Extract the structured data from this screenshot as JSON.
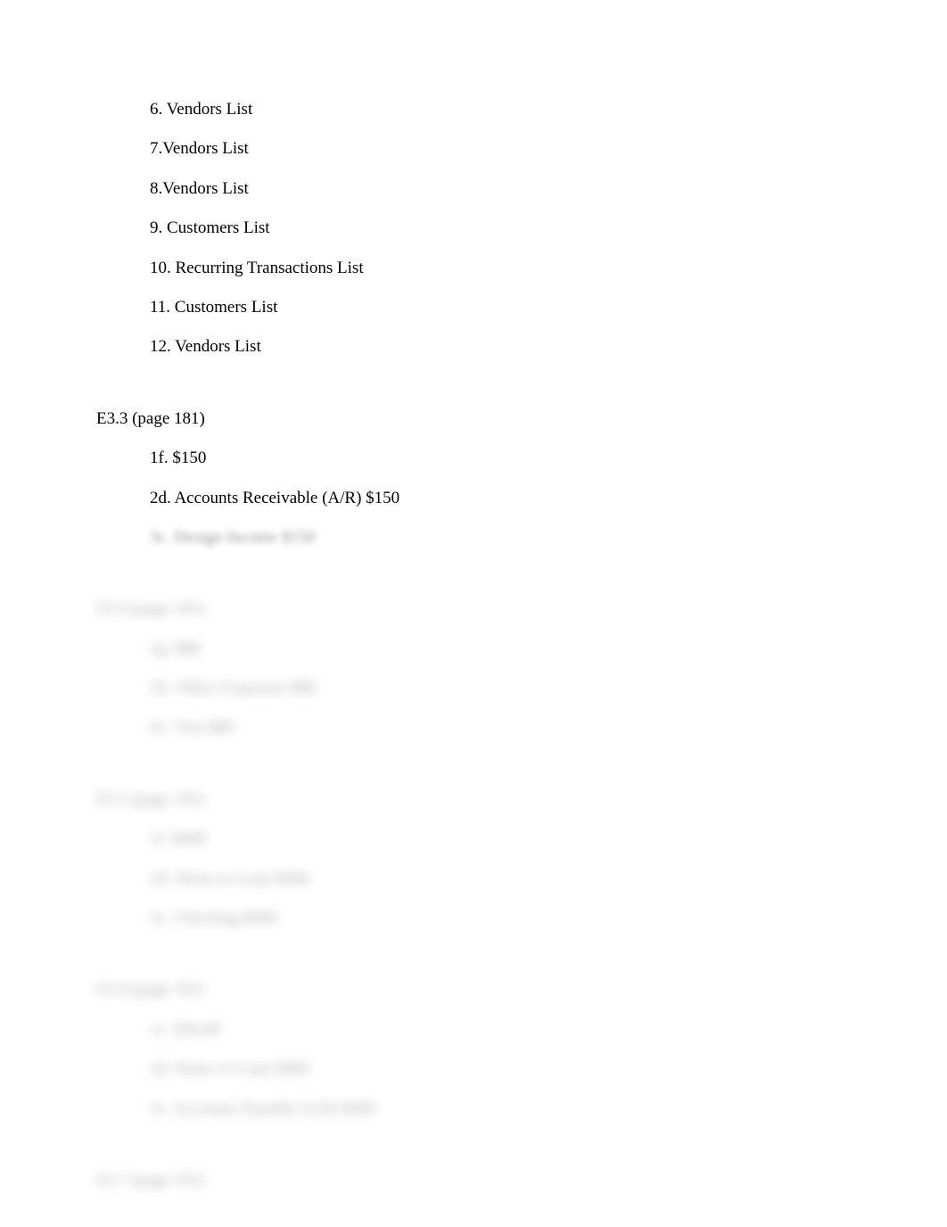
{
  "visible": {
    "top_list": [
      "6. Vendors List",
      "7.Vendors List",
      "8.Vendors List",
      "9. Customers List",
      "10. Recurring Transactions List",
      "11. Customers List",
      "12. Vendors List"
    ],
    "section_heading": "E3.3 (page 181)",
    "section_items": [
      "1f.  $150",
      "2d. Accounts Receivable (A/R) $150"
    ]
  },
  "blurred": {
    "line_1": "3c. Design Income $150",
    "sections": [
      {
        "heading": "E3.4 (page 181)",
        "items": [
          "1g. $80",
          "2b. Office Expenses $80",
          "3c. Visa $80"
        ]
      },
      {
        "heading": "E3.5 (page 181)",
        "items": [
          "1f. $400",
          "2d. Notes to Loan $400",
          "3c. Checking $400"
        ]
      },
      {
        "heading": "E3.6 (page 181)",
        "items": [
          "1c. $50.00",
          "2d. Notes to Loan $400",
          "3c. Accounts Payable (A/P) $400"
        ]
      },
      {
        "heading": "E3.7 (page 181)",
        "items": []
      }
    ]
  }
}
